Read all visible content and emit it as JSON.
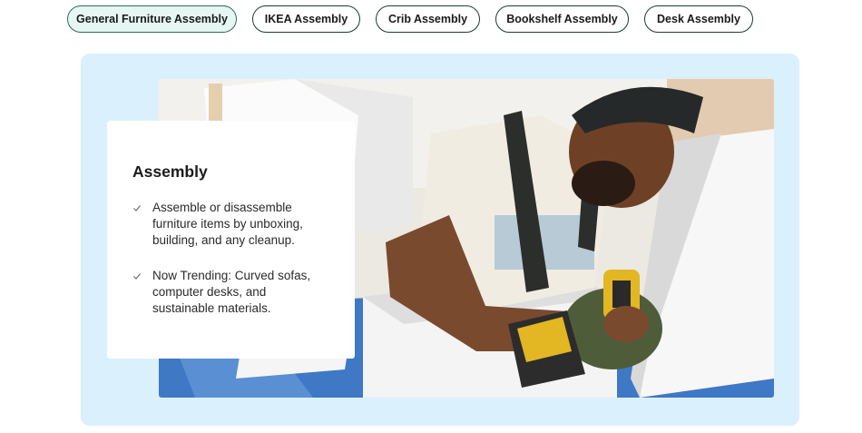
{
  "tabs": [
    {
      "label": "General Furniture Assembly",
      "active": true
    },
    {
      "label": "IKEA Assembly",
      "active": false
    },
    {
      "label": "Crib Assembly",
      "active": false
    },
    {
      "label": "Bookshelf Assembly",
      "active": false
    },
    {
      "label": "Desk Assembly",
      "active": false
    }
  ],
  "card": {
    "title": "Assembly",
    "bullets": [
      "Assemble or disassemble furniture items by unboxing, building, and any cleanup.",
      "Now Trending: Curved sofas, computer desks, and sustainable materials."
    ]
  },
  "icons": {
    "bullet": "check-icon"
  },
  "colors": {
    "panel_background": "#dbf0fd",
    "active_tab_background": "#e6f6f2",
    "tab_border": "#1f3a33"
  }
}
